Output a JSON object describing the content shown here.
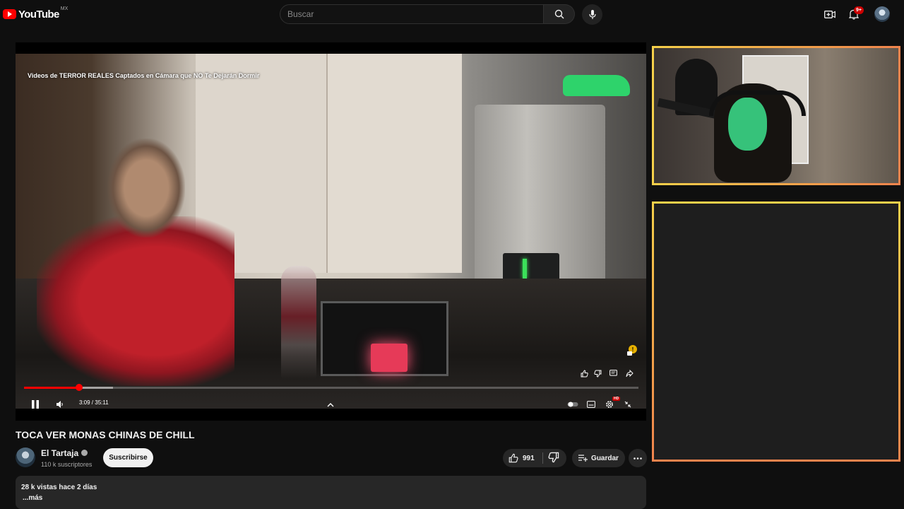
{
  "header": {
    "logo_text": "YouTube",
    "country": "MX",
    "search_placeholder": "Buscar",
    "notifications_badge": "9+",
    "icons": [
      "create-icon",
      "bell-icon",
      "search-icon",
      "mic-icon"
    ]
  },
  "player": {
    "overlay_title": "Videos de TERROR REALES Captados en Cámara que NO Te Dejarán Dormir",
    "time_display": "3:09 / 35:11",
    "progress_played": 0.09,
    "progress_loaded": 0.145,
    "hd_badge": "HD"
  },
  "video": {
    "title": "TOCA VER MONAS CHINAS DE CHILL",
    "channel_name": "El Tartaja",
    "subscribers": "110 k suscriptores",
    "subscribe_label": "Suscribirse",
    "likes": "991",
    "save_label": "Guardar"
  },
  "description": {
    "stats": "28 k vistas  hace 2 días",
    "more": "...más"
  },
  "colors": {
    "accent": "#ff0000",
    "frame_border_start": "#f5d04a",
    "frame_border_end": "#f0834d",
    "background": "#0f0f0f"
  }
}
